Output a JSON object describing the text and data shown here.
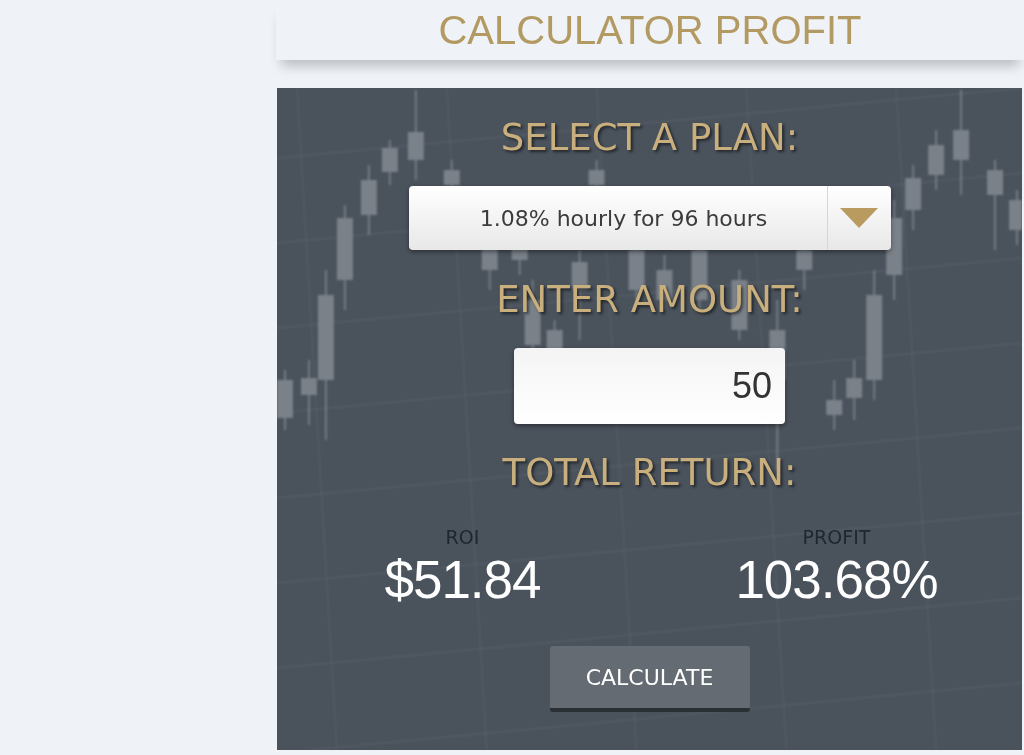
{
  "header": {
    "title": "CALCULATOR PROFIT"
  },
  "calculator": {
    "plan": {
      "label": "SELECT A PLAN:",
      "selected_plan": "1.08% hourly for 96 hours"
    },
    "amount": {
      "label": "ENTER AMOUNT:",
      "value": "50"
    },
    "total_return": {
      "label": "TOTAL RETURN:",
      "results": [
        {
          "label": "ROI",
          "value": "$51.84"
        },
        {
          "label": "PROFIT",
          "value": "103.68%"
        }
      ]
    },
    "calculate_button": "CALCULATE"
  }
}
